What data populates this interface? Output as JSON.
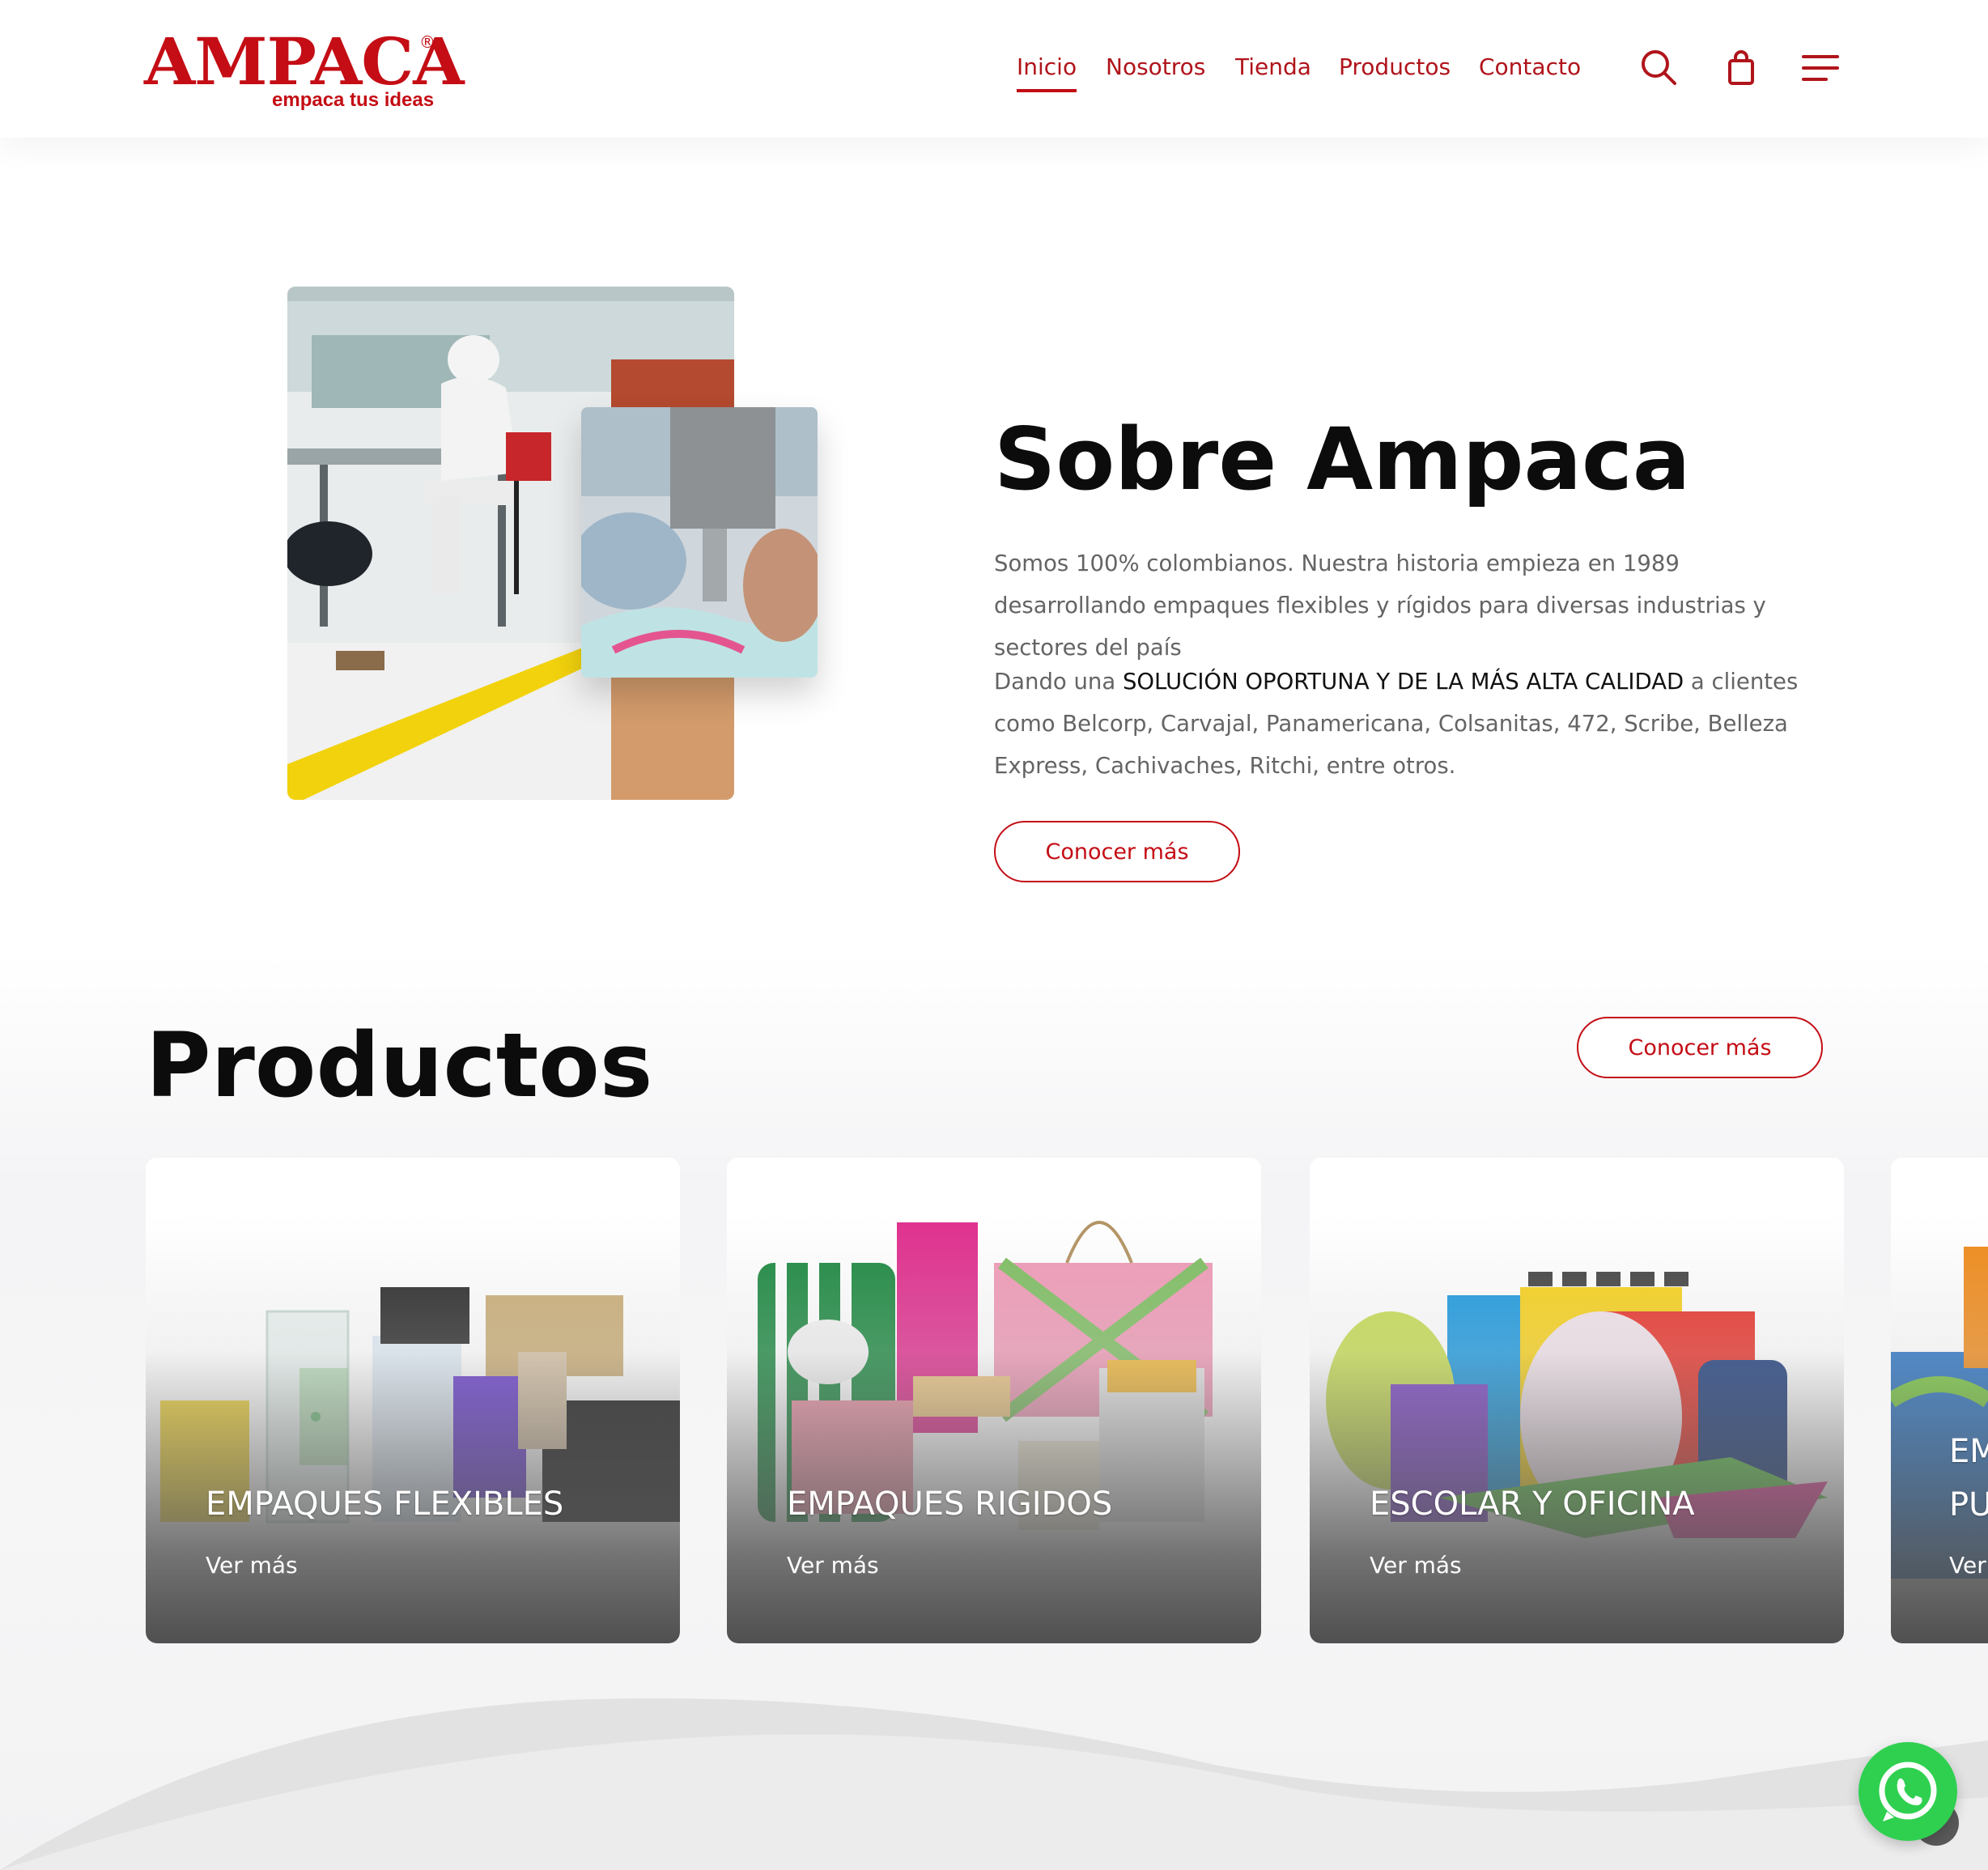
{
  "brand": {
    "name": "AMPACA",
    "registered": "®",
    "tagline": "empaca tus ideas",
    "primary_color": "#c40d15",
    "whatsapp_color": "#2fd04f"
  },
  "nav": {
    "items": [
      {
        "label": "Inicio",
        "active": true
      },
      {
        "label": "Nosotros",
        "active": false
      },
      {
        "label": "Tienda",
        "active": false
      },
      {
        "label": "Productos",
        "active": false
      },
      {
        "label": "Contacto",
        "active": false
      }
    ],
    "icons": [
      "search-icon",
      "shopping-bag-icon",
      "menu-icon"
    ]
  },
  "about": {
    "title": "Sobre Ampaca",
    "paragraph1": "Somos 100% colombianos. Nuestra historia empieza en 1989 desarrollando empaques flexibles y rígidos para diversas industrias y sectores del país",
    "paragraph2_before": "Dando una ",
    "paragraph2_strong": "SOLUCIÓN OPORTUNA Y DE LA MÁS ALTA CALIDAD",
    "paragraph2_after": " a clientes como Belcorp, Carvajal, Panamericana, Colsanitas, 472, Scribe, Belleza Express, Cachivaches, Ritchi, entre otros.",
    "button": "Conocer más"
  },
  "products": {
    "title": "Productos",
    "button": "Conocer más",
    "cards": [
      {
        "title": "EMPAQUES FLEXIBLES",
        "link": "Ver más"
      },
      {
        "title": "EMPAQUES RIGIDOS",
        "link": "Ver más"
      },
      {
        "title": "ESCOLAR Y OFICINA",
        "link": "Ver más"
      },
      {
        "title": "EM PU",
        "link": "Ver"
      }
    ]
  }
}
